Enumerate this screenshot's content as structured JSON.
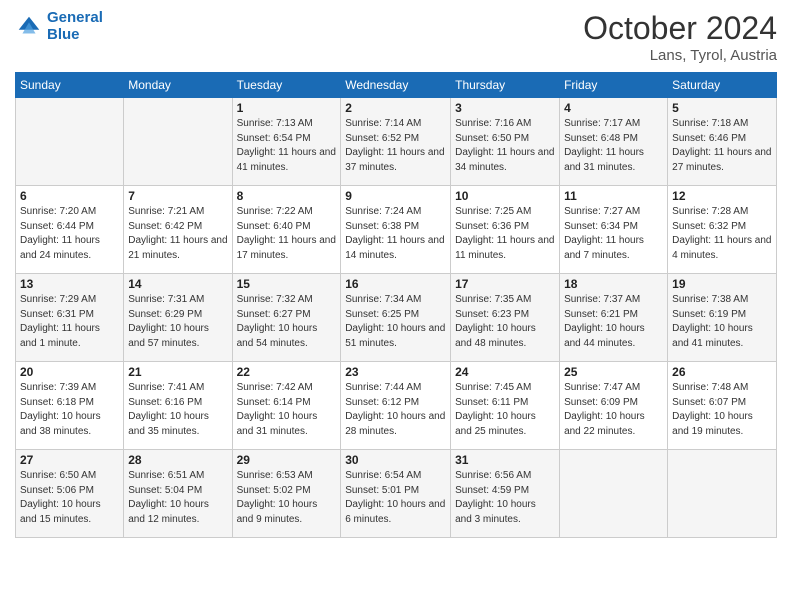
{
  "header": {
    "logo_line1": "General",
    "logo_line2": "Blue",
    "month": "October 2024",
    "location": "Lans, Tyrol, Austria"
  },
  "weekdays": [
    "Sunday",
    "Monday",
    "Tuesday",
    "Wednesday",
    "Thursday",
    "Friday",
    "Saturday"
  ],
  "weeks": [
    [
      {
        "day": "",
        "info": ""
      },
      {
        "day": "",
        "info": ""
      },
      {
        "day": "1",
        "info": "Sunrise: 7:13 AM\nSunset: 6:54 PM\nDaylight: 11 hours and 41 minutes."
      },
      {
        "day": "2",
        "info": "Sunrise: 7:14 AM\nSunset: 6:52 PM\nDaylight: 11 hours and 37 minutes."
      },
      {
        "day": "3",
        "info": "Sunrise: 7:16 AM\nSunset: 6:50 PM\nDaylight: 11 hours and 34 minutes."
      },
      {
        "day": "4",
        "info": "Sunrise: 7:17 AM\nSunset: 6:48 PM\nDaylight: 11 hours and 31 minutes."
      },
      {
        "day": "5",
        "info": "Sunrise: 7:18 AM\nSunset: 6:46 PM\nDaylight: 11 hours and 27 minutes."
      }
    ],
    [
      {
        "day": "6",
        "info": "Sunrise: 7:20 AM\nSunset: 6:44 PM\nDaylight: 11 hours and 24 minutes."
      },
      {
        "day": "7",
        "info": "Sunrise: 7:21 AM\nSunset: 6:42 PM\nDaylight: 11 hours and 21 minutes."
      },
      {
        "day": "8",
        "info": "Sunrise: 7:22 AM\nSunset: 6:40 PM\nDaylight: 11 hours and 17 minutes."
      },
      {
        "day": "9",
        "info": "Sunrise: 7:24 AM\nSunset: 6:38 PM\nDaylight: 11 hours and 14 minutes."
      },
      {
        "day": "10",
        "info": "Sunrise: 7:25 AM\nSunset: 6:36 PM\nDaylight: 11 hours and 11 minutes."
      },
      {
        "day": "11",
        "info": "Sunrise: 7:27 AM\nSunset: 6:34 PM\nDaylight: 11 hours and 7 minutes."
      },
      {
        "day": "12",
        "info": "Sunrise: 7:28 AM\nSunset: 6:32 PM\nDaylight: 11 hours and 4 minutes."
      }
    ],
    [
      {
        "day": "13",
        "info": "Sunrise: 7:29 AM\nSunset: 6:31 PM\nDaylight: 11 hours and 1 minute."
      },
      {
        "day": "14",
        "info": "Sunrise: 7:31 AM\nSunset: 6:29 PM\nDaylight: 10 hours and 57 minutes."
      },
      {
        "day": "15",
        "info": "Sunrise: 7:32 AM\nSunset: 6:27 PM\nDaylight: 10 hours and 54 minutes."
      },
      {
        "day": "16",
        "info": "Sunrise: 7:34 AM\nSunset: 6:25 PM\nDaylight: 10 hours and 51 minutes."
      },
      {
        "day": "17",
        "info": "Sunrise: 7:35 AM\nSunset: 6:23 PM\nDaylight: 10 hours and 48 minutes."
      },
      {
        "day": "18",
        "info": "Sunrise: 7:37 AM\nSunset: 6:21 PM\nDaylight: 10 hours and 44 minutes."
      },
      {
        "day": "19",
        "info": "Sunrise: 7:38 AM\nSunset: 6:19 PM\nDaylight: 10 hours and 41 minutes."
      }
    ],
    [
      {
        "day": "20",
        "info": "Sunrise: 7:39 AM\nSunset: 6:18 PM\nDaylight: 10 hours and 38 minutes."
      },
      {
        "day": "21",
        "info": "Sunrise: 7:41 AM\nSunset: 6:16 PM\nDaylight: 10 hours and 35 minutes."
      },
      {
        "day": "22",
        "info": "Sunrise: 7:42 AM\nSunset: 6:14 PM\nDaylight: 10 hours and 31 minutes."
      },
      {
        "day": "23",
        "info": "Sunrise: 7:44 AM\nSunset: 6:12 PM\nDaylight: 10 hours and 28 minutes."
      },
      {
        "day": "24",
        "info": "Sunrise: 7:45 AM\nSunset: 6:11 PM\nDaylight: 10 hours and 25 minutes."
      },
      {
        "day": "25",
        "info": "Sunrise: 7:47 AM\nSunset: 6:09 PM\nDaylight: 10 hours and 22 minutes."
      },
      {
        "day": "26",
        "info": "Sunrise: 7:48 AM\nSunset: 6:07 PM\nDaylight: 10 hours and 19 minutes."
      }
    ],
    [
      {
        "day": "27",
        "info": "Sunrise: 6:50 AM\nSunset: 5:06 PM\nDaylight: 10 hours and 15 minutes."
      },
      {
        "day": "28",
        "info": "Sunrise: 6:51 AM\nSunset: 5:04 PM\nDaylight: 10 hours and 12 minutes."
      },
      {
        "day": "29",
        "info": "Sunrise: 6:53 AM\nSunset: 5:02 PM\nDaylight: 10 hours and 9 minutes."
      },
      {
        "day": "30",
        "info": "Sunrise: 6:54 AM\nSunset: 5:01 PM\nDaylight: 10 hours and 6 minutes."
      },
      {
        "day": "31",
        "info": "Sunrise: 6:56 AM\nSunset: 4:59 PM\nDaylight: 10 hours and 3 minutes."
      },
      {
        "day": "",
        "info": ""
      },
      {
        "day": "",
        "info": ""
      }
    ]
  ]
}
